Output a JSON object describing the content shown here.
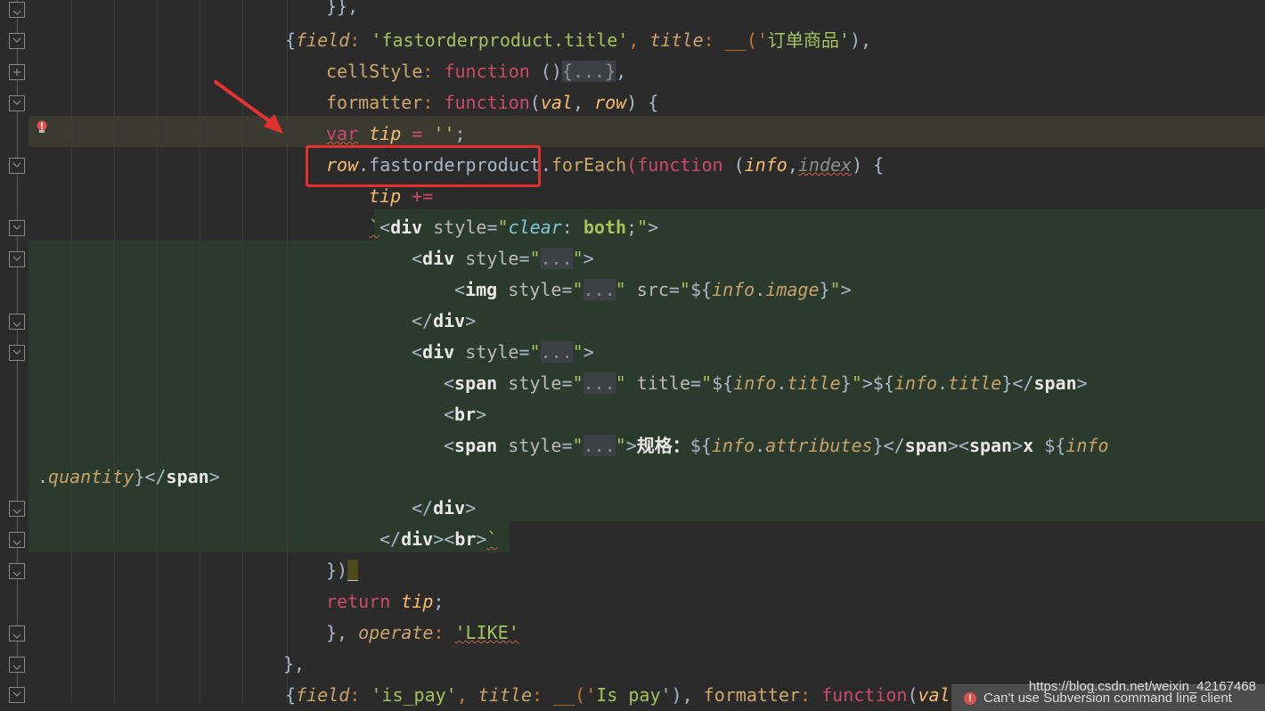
{
  "editor": {
    "lines": {
      "l0": {
        "a": "}},"
      },
      "l1": {
        "b1": "{",
        "field": "field",
        "c1": ": ",
        "s1": "'fastorderproduct.title'",
        "c2": ", ",
        "title": "title",
        "c3": ": __('",
        "zh": "订单商品",
        "c4": "'",
        "c5": "),"
      },
      "l2": {
        "prop": "cellStyle",
        "c1": ": ",
        "fn": "function",
        "c2": " ()",
        "ph": "{...}",
        "c3": ","
      },
      "l3": {
        "prop": "formatter",
        "c1": ": ",
        "fn": "function",
        "c2": "(",
        "p1": "val",
        "c3": ", ",
        "p2": "row",
        "c4": ") {"
      },
      "l4": {
        "kw": "var",
        "sp": " ",
        "var": "tip",
        "eq": " = ",
        "str": "''",
        "semi": ";"
      },
      "l5": {
        "row": "row",
        "dot": ".",
        "name": "fastorderproduct",
        "dot2": ".",
        "meth": "forEach",
        "par": "(",
        "fn": "function",
        "sp": " (",
        "p1": "info",
        "comma": ",",
        "p2": "index",
        "close": ") {"
      },
      "l6": {
        "var": "tip",
        "op": " +="
      },
      "l7": {
        "bt": "`",
        "lt": "<",
        "tag": "div",
        "sp": " ",
        "attr": "style",
        "eq": "=",
        "q1": "\"",
        "aval": "clear",
        "colon": ": ",
        "bold": "both",
        "semi": ";",
        "q2": "\"",
        "gt": ">"
      },
      "l8": {
        "lt": "<",
        "tag": "div",
        "sp": " ",
        "attr": "style",
        "eq": "=",
        "q1": "\"",
        "ph": "...",
        "q2": "\"",
        "gt": ">"
      },
      "l9": {
        "lt": "<",
        "tag": "img",
        "sp": " ",
        "attr": "style",
        "eq": "=",
        "q1": "\"",
        "ph": "...",
        "q2": "\"",
        "sp2": " ",
        "attr2": "src",
        "eq2": "=",
        "q3": "\"",
        "d1": "${",
        "v1": "info",
        "dot": ".",
        "v2": "image",
        "d2": "}",
        "q4": "\"",
        "gt": ">"
      },
      "l10": {
        "lt": "</",
        "tag": "div",
        "gt": ">"
      },
      "l11": {
        "lt": "<",
        "tag": "div",
        "sp": " ",
        "attr": "style",
        "eq": "=",
        "q1": "\"",
        "ph": "...",
        "q2": "\"",
        "gt": ">"
      },
      "l12": {
        "lt": "<",
        "tag": "span",
        "sp": " ",
        "attr": "style",
        "eq": "=",
        "q1": "\"",
        "ph": "...",
        "q2": "\"",
        "sp2": " ",
        "attr2": "title",
        "eq2": "=",
        "q3": "\"",
        "d1": "${",
        "v1": "info",
        "dot": ".",
        "v2": "title",
        "d2": "}",
        "q4": "\"",
        "gt": ">",
        "d3": "${",
        "v3": "info",
        "dot2": ".",
        "v4": "title",
        "d4": "}",
        "lt2": "</",
        "tag2": "span",
        "gt2": ">"
      },
      "l13": {
        "lt": "<",
        "tag": "br",
        "gt": ">"
      },
      "l14": {
        "lt": "<",
        "tag": "span",
        "sp": " ",
        "attr": "style",
        "eq": "=",
        "q1": "\"",
        "ph": "...",
        "q2": "\"",
        "gt": ">",
        "zh": "规格：",
        "d1": "${",
        "v1": "info",
        "dot": ".",
        "v2": "attributes",
        "d2": "}",
        "lt2": "</",
        "tag2": "span",
        "gt2": ">",
        "lt3": "<",
        "tag3": "span",
        "gt3": ">",
        "x": "x",
        "sp3": " ",
        "d3": "${",
        "v3": "info"
      },
      "l15": {
        "dot": ".",
        "v1": "quantity",
        "d": "}",
        "lt": "</",
        "tag": "span",
        "gt": ">"
      },
      "l16": {
        "lt": "</",
        "tag": "div",
        "gt": ">"
      },
      "l17": {
        "lt": "</",
        "tag": "div",
        "gt": ">",
        "lt2": "<",
        "tag2": "br",
        "gt2": ">",
        "bt": "`"
      },
      "l18": {
        "a": "})",
        "caret": "_"
      },
      "l19": {
        "kw": "return",
        "sp": " ",
        "var": "tip",
        "semi": ";"
      },
      "l20": {
        "a": "}, ",
        "prop": "operate",
        "c1": ": ",
        "str": "'LIKE'"
      },
      "l21": {
        "a": "},"
      },
      "l22": {
        "b1": "{",
        "field": "field",
        "c1": ": ",
        "s1": "'is_pay'",
        "c2": ", ",
        "title": "title",
        "c3": ": __('",
        "s2": "Is pay",
        "c4": "'), ",
        "prop": "formatter",
        "c5": ": ",
        "fn": "function",
        "c6": "(",
        "p1": "val",
        "c7": ","
      }
    }
  },
  "watermark": "https://blog.csdn.net/weixin_42167468",
  "notification": {
    "text": "Can't use Subversion command line client"
  },
  "colors": {
    "background": "#2b2b2b",
    "keyword": "#cc7832",
    "highlight_box": "#e53030",
    "arrow": "#e53030"
  }
}
